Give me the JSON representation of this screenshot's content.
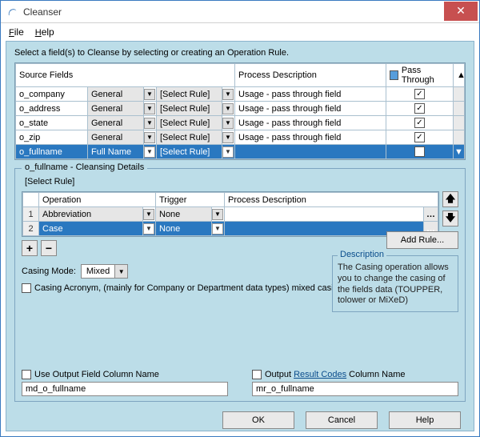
{
  "window": {
    "title": "Cleanser"
  },
  "menu": {
    "file": "File",
    "help": "Help"
  },
  "instruction": "Select a field(s) to Cleanse by selecting or creating an Operation Rule.",
  "sourceTable": {
    "headers": {
      "source": "Source Fields",
      "process": "Process Description",
      "pass": "Pass Through"
    },
    "rows": [
      {
        "field": "o_company",
        "type": "General",
        "rule": "[Select Rule]",
        "process": "Usage - pass through field",
        "pass": true,
        "selected": false
      },
      {
        "field": "o_address",
        "type": "General",
        "rule": "[Select Rule]",
        "process": "Usage - pass through field",
        "pass": true,
        "selected": false
      },
      {
        "field": "o_state",
        "type": "General",
        "rule": "[Select Rule]",
        "process": "Usage - pass through field",
        "pass": true,
        "selected": false
      },
      {
        "field": "o_zip",
        "type": "General",
        "rule": "[Select Rule]",
        "process": "Usage - pass through field",
        "pass": true,
        "selected": false
      },
      {
        "field": "o_fullname",
        "type": "Full Name",
        "rule": "[Select Rule]",
        "process": "",
        "pass": true,
        "selected": true
      }
    ]
  },
  "details": {
    "title": "o_fullname - Cleansing Details",
    "selectRule": "[Select Rule]",
    "columns": {
      "op": "Operation",
      "trigger": "Trigger",
      "process": "Process Description"
    },
    "rows": [
      {
        "n": "1",
        "op": "Abbreviation",
        "trigger": "None",
        "process": "",
        "selected": false
      },
      {
        "n": "2",
        "op": "Case",
        "trigger": "None",
        "process": "",
        "selected": true
      }
    ],
    "casingLabel": "Casing Mode:",
    "casingValue": "Mixed",
    "acronymLabel": "Casing Acronym, (mainly for Company or Department data types) mixed casing",
    "addRule": "Add Rule...",
    "desc": {
      "title": "Description",
      "body": "The Casing operation allows you to change the casing of the fields data (TOUPPER, tolower or MiXeD)"
    }
  },
  "output": {
    "leftLabel": "Use Output Field Column Name",
    "leftValue": "md_o_fullname",
    "rightLabel1": "Output ",
    "rightLink": "Result Codes",
    "rightLabel2": " Column Name",
    "rightValue": "mr_o_fullname"
  },
  "footer": {
    "ok": "OK",
    "cancel": "Cancel",
    "help": "Help"
  }
}
